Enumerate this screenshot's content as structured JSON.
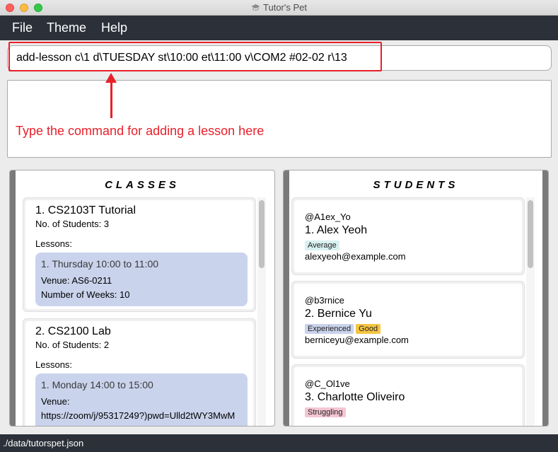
{
  "window": {
    "title": "Tutor's Pet"
  },
  "menu": {
    "file": "File",
    "theme": "Theme",
    "help": "Help"
  },
  "command": {
    "value": "add-lesson c\\1 d\\TUESDAY st\\10:00 et\\11:00 v\\COM2 #02-02 r\\13"
  },
  "annotation": {
    "text": "Type the command for adding a lesson here",
    "color": "#e8202a"
  },
  "classes_panel": {
    "heading": "CLASSES",
    "items": [
      {
        "title": "1.  CS2103T Tutorial",
        "count": "No. of Students:  3",
        "lessons_label": "Lessons:",
        "lesson": {
          "time": "1. Thursday 10:00 to 11:00",
          "venue": "Venue: AS6-0211",
          "weeks": "Number of Weeks: 10"
        }
      },
      {
        "title": "2.  CS2100 Lab",
        "count": "No. of Students:  2",
        "lessons_label": "Lessons:",
        "lesson": {
          "time": "1. Monday 14:00 to 15:00",
          "venue": "Venue:",
          "venue_url": "https://zoom/j/95317249?)pwd=Ulld2tWY3MwM"
        }
      }
    ]
  },
  "students_panel": {
    "heading": "STUDENTS",
    "items": [
      {
        "handle": "@A1ex_Yo",
        "name": "1.  Alex Yeoh",
        "tags": [
          {
            "label": "Average",
            "color": "#d8f0f0"
          }
        ],
        "email": "alexyeoh@example.com"
      },
      {
        "handle": "@b3rnice",
        "name": "2.  Bernice Yu",
        "tags": [
          {
            "label": "Experienced",
            "color": "#c9d3ec"
          },
          {
            "label": "Good",
            "color": "#f5c542"
          }
        ],
        "email": "berniceyu@example.com"
      },
      {
        "handle": "@C_Ol1ve",
        "name": "3.  Charlotte Oliveiro",
        "tags": [
          {
            "label": "Struggling",
            "color": "#f4c6d4"
          }
        ],
        "email": ""
      }
    ]
  },
  "status": {
    "path": "./data/tutorspet.json"
  }
}
